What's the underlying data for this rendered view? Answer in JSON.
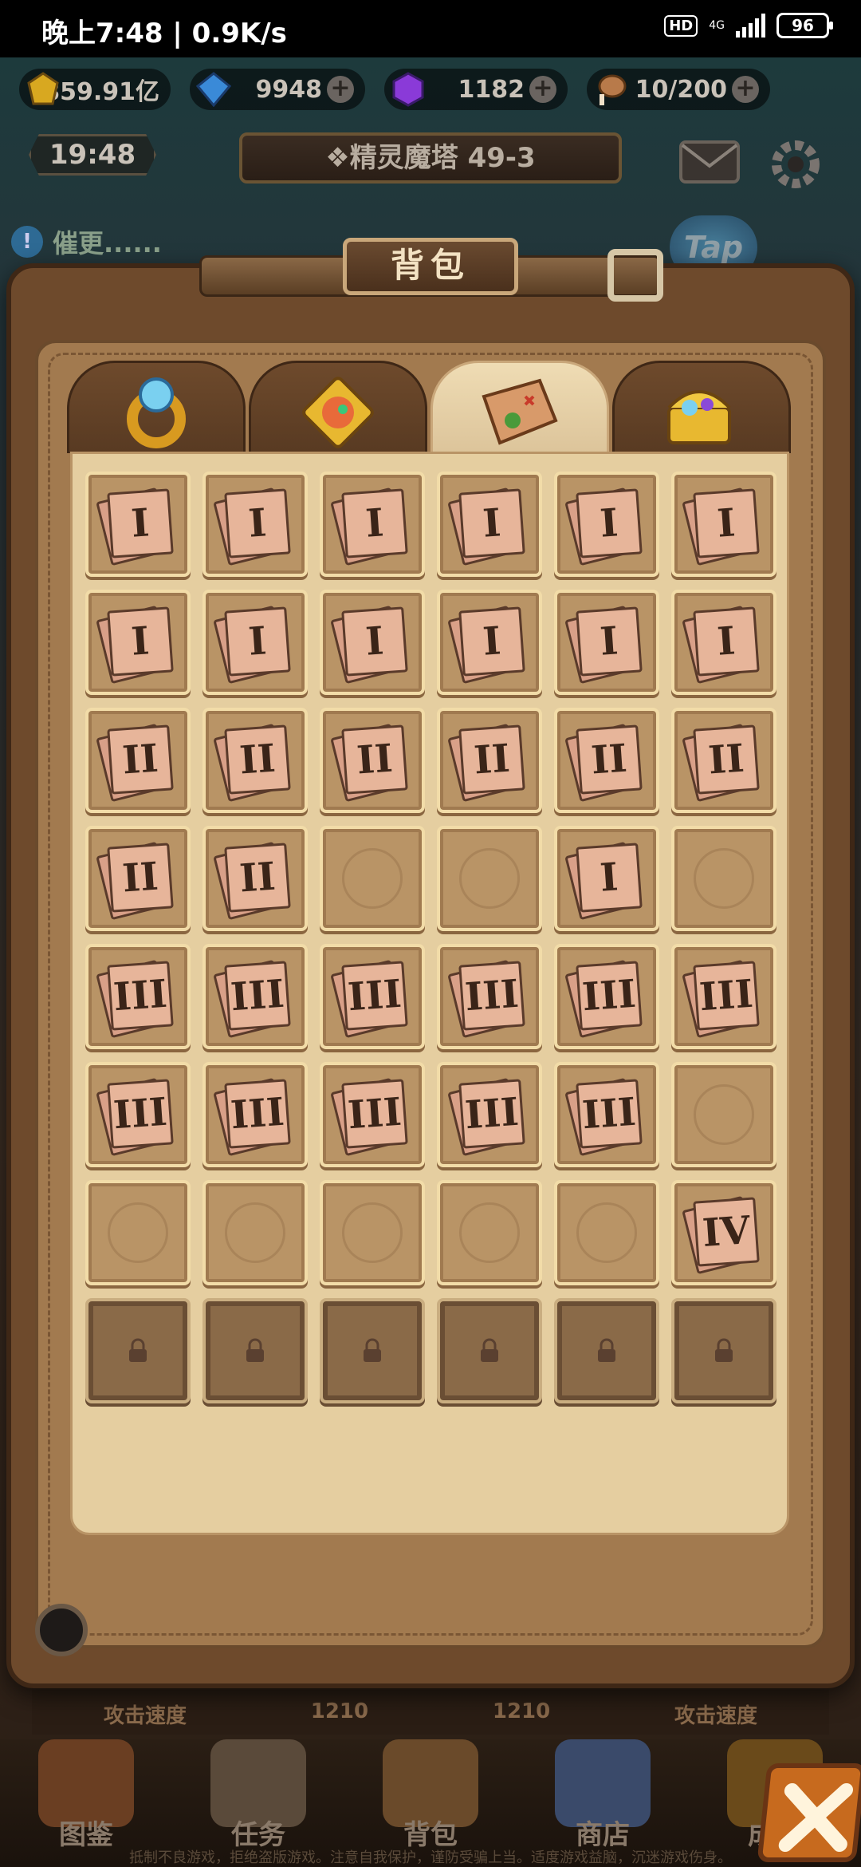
{
  "status_bar": {
    "time": "晚上7:48 | 0.9K/s",
    "hd": "HD",
    "network": "4G",
    "battery": "96"
  },
  "currencies": [
    {
      "icon": "gold-gem-icon",
      "value": "859.91亿",
      "color": "#d8a820",
      "has_plus": false
    },
    {
      "icon": "blue-diamond-icon",
      "value": "9948",
      "color": "#3a8ad8",
      "has_plus": true
    },
    {
      "icon": "purple-crystal-icon",
      "value": "1182",
      "color": "#8a3ad8",
      "has_plus": true
    },
    {
      "icon": "meat-stamina-icon",
      "value": "10/200",
      "color": "#b87a4a",
      "has_plus": true
    }
  ],
  "hud": {
    "clock": "19:48",
    "stage": "❖精灵魔塔 49-3",
    "notice": "催更......",
    "tap": "Tap"
  },
  "panel": {
    "title": "背包",
    "tabs": [
      {
        "name": "tab-equipment",
        "icon": "ring-icon",
        "active": false
      },
      {
        "name": "tab-fragments",
        "icon": "puzzle-pet-icon",
        "active": false
      },
      {
        "name": "tab-maps",
        "icon": "treasure-map-icon",
        "active": true
      },
      {
        "name": "tab-chest",
        "icon": "treasure-chest-icon",
        "active": false
      }
    ],
    "slots": [
      "I",
      "I",
      "I",
      "I",
      "I",
      "I",
      "I",
      "I",
      "I",
      "I",
      "I",
      "I",
      "II",
      "II",
      "II",
      "II",
      "II",
      "II",
      "II",
      "II",
      "",
      "",
      "I",
      "",
      "III",
      "III",
      "III",
      "III",
      "III",
      "III",
      "III",
      "III",
      "III",
      "III",
      "III",
      "",
      "",
      "",
      "",
      "",
      "",
      "IV",
      "lock",
      "lock",
      "lock",
      "lock",
      "lock",
      "lock"
    ]
  },
  "background_stats": {
    "left_label": "攻击速度",
    "left_value": "1210",
    "right_value": "1210",
    "right_label": "攻击速度"
  },
  "bottom_nav": [
    "图鉴",
    "任务",
    "背包",
    "商店",
    "成就"
  ],
  "footer": "抵制不良游戏，拒绝盗版游戏。注意自我保护，谨防受骗上当。适度游戏益脑，沉迷游戏伤身。"
}
